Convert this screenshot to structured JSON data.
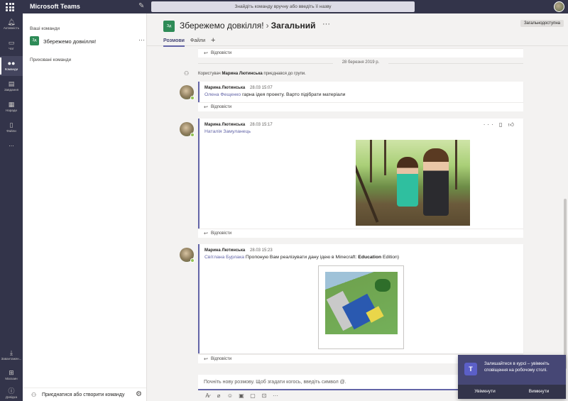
{
  "app": {
    "title": "Microsoft Teams"
  },
  "search": {
    "placeholder": "Знайдіть команду вручну або введіть її назву"
  },
  "rail": {
    "items": [
      {
        "label": "Активність",
        "icon": "bell-icon"
      },
      {
        "label": "Чат",
        "icon": "chat-icon"
      },
      {
        "label": "Команди",
        "icon": "teams-icon"
      },
      {
        "label": "Завдання",
        "icon": "assignments-icon"
      },
      {
        "label": "Наради",
        "icon": "calendar-icon"
      },
      {
        "label": "Файли",
        "icon": "files-icon"
      },
      {
        "label": "...",
        "icon": "more-icon"
      }
    ],
    "bottom": [
      {
        "label": "Завантажен...",
        "icon": "download-icon"
      },
      {
        "label": "Магазин",
        "icon": "store-icon"
      },
      {
        "label": "Довідка",
        "icon": "help-icon"
      }
    ]
  },
  "teams_pane": {
    "your_teams": "Ваші команди",
    "team": {
      "tile": "Зд",
      "name": "Збережемо довкілля!"
    },
    "hidden_teams": "Приховані команди",
    "join": "Приєднатися або створити команду"
  },
  "channel": {
    "tile": "Зд",
    "team_name": "Збережемо довкілля!",
    "channel_name": "Загальний",
    "badge": "Загальнодоступна",
    "tabs": [
      "Розмови",
      "Файли"
    ]
  },
  "feed": {
    "reply_label": "Відповісти",
    "date_divider": "28 березня 2019 р.",
    "system_message": {
      "prefix": "Користувач",
      "user": "Марина Лютинська",
      "suffix": "приєднався до групи."
    },
    "posts": [
      {
        "author": "Марина Лютинська",
        "time": "28.03 15:07",
        "mention": "Олена Фещенко",
        "text": " гарна ідея проекту. Варто підібрати матеріали"
      },
      {
        "author": "Марина Лютинська",
        "time": "28.03 15:17",
        "mention": "Наталія Замуланець",
        "text": ""
      },
      {
        "author": "Марина Лютинська",
        "time": "28.03 15:23",
        "mention": "Світлана Бурлака",
        "text": " Пропоную Вам реалізувати дану ідею в Minecraft: ",
        "bold": "Education",
        "text_after": " Edition)"
      }
    ]
  },
  "composer": {
    "placeholder": "Почніть нову розмову. Щоб згадати когось, введіть символ @."
  },
  "toast": {
    "logo": "T",
    "message": "Залишайтеся в курсі – увімкніть сповіщення на робочому столі.",
    "enable": "Увімкнути",
    "disable": "Вимкнути"
  },
  "colors": {
    "rail": "#33344a",
    "accent": "#6264a7",
    "team_tile": "#2e8b57",
    "toast": "#464775"
  }
}
